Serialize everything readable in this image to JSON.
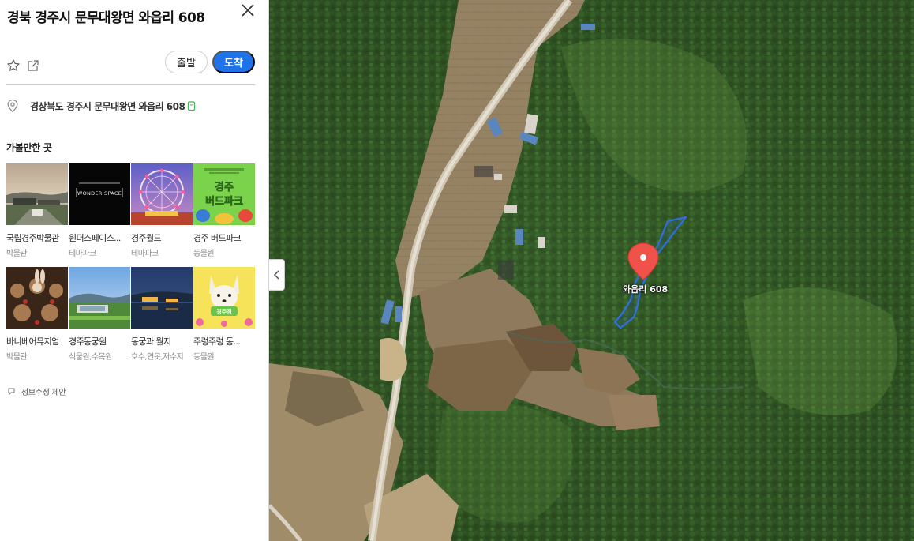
{
  "place": {
    "title": "경북 경주시 문무대왕면 와읍리 608",
    "address": "경상북도 경주시 문무대왕면 와읍리 608"
  },
  "actions": {
    "depart_label": "출발",
    "arrive_label": "도착"
  },
  "nearby": {
    "section_title": "가볼만한 곳",
    "items": [
      {
        "name": "국립경주박물관",
        "category": "박물관"
      },
      {
        "name": "원더스페이스...",
        "category": "테마파크",
        "thumb_text": "WONDER SPACE"
      },
      {
        "name": "경주월드",
        "category": "테마파크"
      },
      {
        "name": "경주 버드파크",
        "category": "동물원",
        "thumb_text": "경주\n버드파크"
      },
      {
        "name": "바니베어뮤지엄",
        "category": "박물관"
      },
      {
        "name": "경주동궁원",
        "category": "식물원,수목원"
      },
      {
        "name": "동궁과 월지",
        "category": "호수,연못,저수지"
      },
      {
        "name": "주렁주렁 동...",
        "category": "동물원",
        "thumb_text": "경주점"
      }
    ]
  },
  "suggest_label": "정보수정 제안",
  "map": {
    "marker_label": "와읍리 608",
    "marker_color": "#f0524a",
    "boundary_color": "#2f6fe0"
  },
  "colors": {
    "accent": "#1e73e8"
  }
}
